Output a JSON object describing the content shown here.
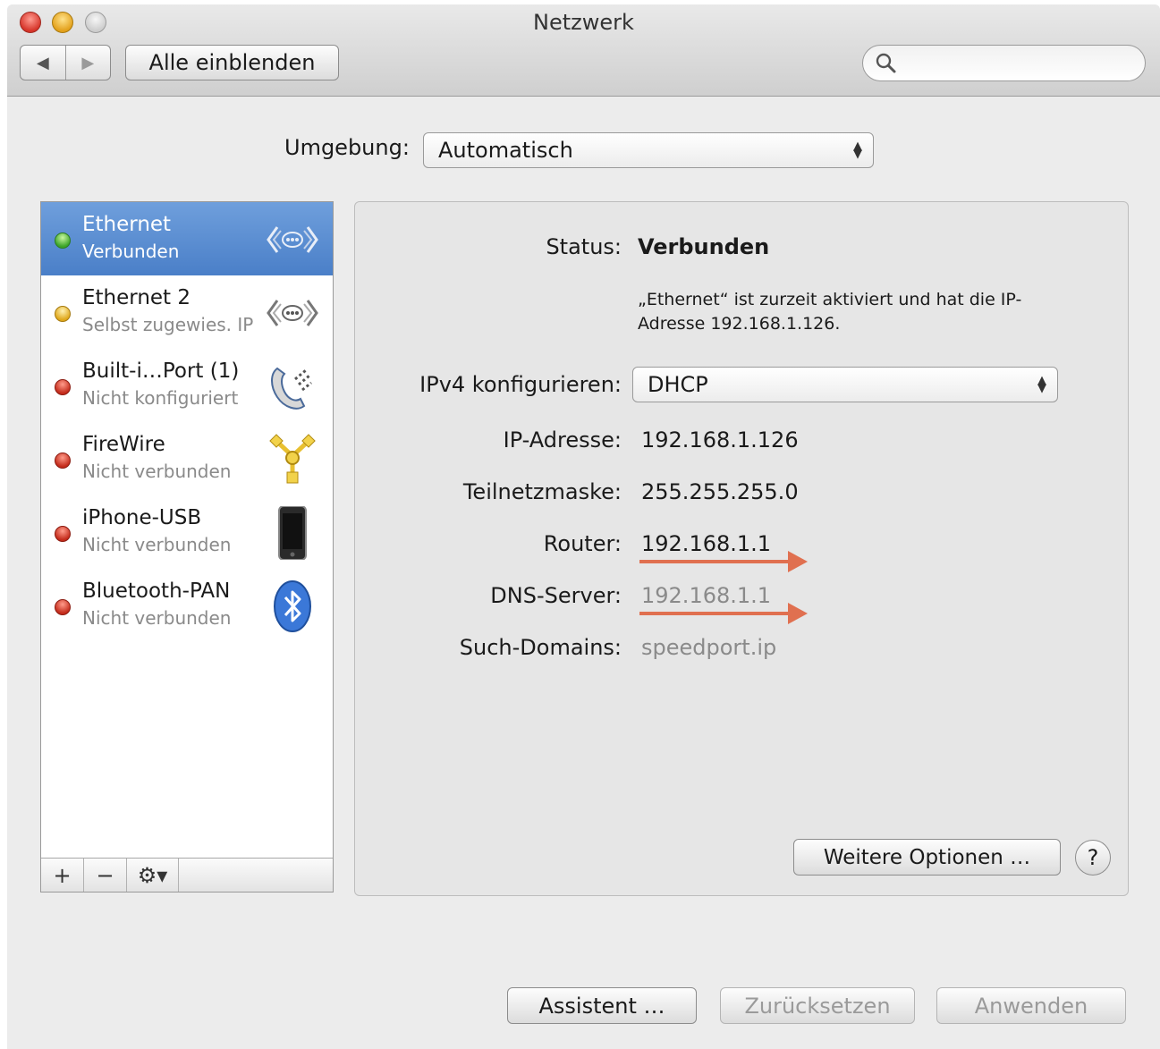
{
  "window": {
    "title": "Netzwerk"
  },
  "toolbar": {
    "back_icon": "◀",
    "forward_icon": "▶",
    "show_all_label": "Alle einblenden",
    "search_placeholder": ""
  },
  "location": {
    "label": "Umgebung:",
    "value": "Automatisch"
  },
  "services": [
    {
      "name": "Ethernet",
      "status": "Verbunden",
      "status_color": "green",
      "icon": "ethernet-icon",
      "selected": true
    },
    {
      "name": "Ethernet 2",
      "status": "Selbst zugewies. IP",
      "status_color": "yellow",
      "icon": "ethernet-icon",
      "selected": false
    },
    {
      "name": "Built-i…Port (1)",
      "status": "Nicht konfiguriert",
      "status_color": "red",
      "icon": "modem-phone-icon",
      "selected": false
    },
    {
      "name": "FireWire",
      "status": "Nicht verbunden",
      "status_color": "red",
      "icon": "firewire-icon",
      "selected": false
    },
    {
      "name": "iPhone-USB",
      "status": "Nicht verbunden",
      "status_color": "red",
      "icon": "iphone-icon",
      "selected": false
    },
    {
      "name": "Bluetooth-PAN",
      "status": "Nicht verbunden",
      "status_color": "red",
      "icon": "bluetooth-icon",
      "selected": false
    }
  ],
  "list_bar": {
    "add": "+",
    "remove": "−",
    "action": "⚙▾"
  },
  "detail": {
    "status_label": "Status:",
    "status_value": "Verbunden",
    "status_description": "„Ethernet“ ist zurzeit aktiviert und hat die IP-Adresse 192.168.1.126.",
    "ipv4_label": "IPv4 konfigurieren:",
    "ipv4_value": "DHCP",
    "ip_label": "IP-Adresse:",
    "ip_value": "192.168.1.126",
    "subnet_label": "Teilnetzmaske:",
    "subnet_value": "255.255.255.0",
    "router_label": "Router:",
    "router_value": "192.168.1.1",
    "dns_label": "DNS-Server:",
    "dns_value": "192.168.1.1",
    "domains_label": "Such-Domains:",
    "domains_value": "speedport.ip",
    "more_options_label": "Weitere Optionen …",
    "help_label": "?"
  },
  "footer": {
    "assistant_label": "Assistent …",
    "revert_label": "Zurücksetzen",
    "apply_label": "Anwenden"
  },
  "colors": {
    "selection": "#4a7fc8",
    "annotation_arrow": "#e07050"
  }
}
